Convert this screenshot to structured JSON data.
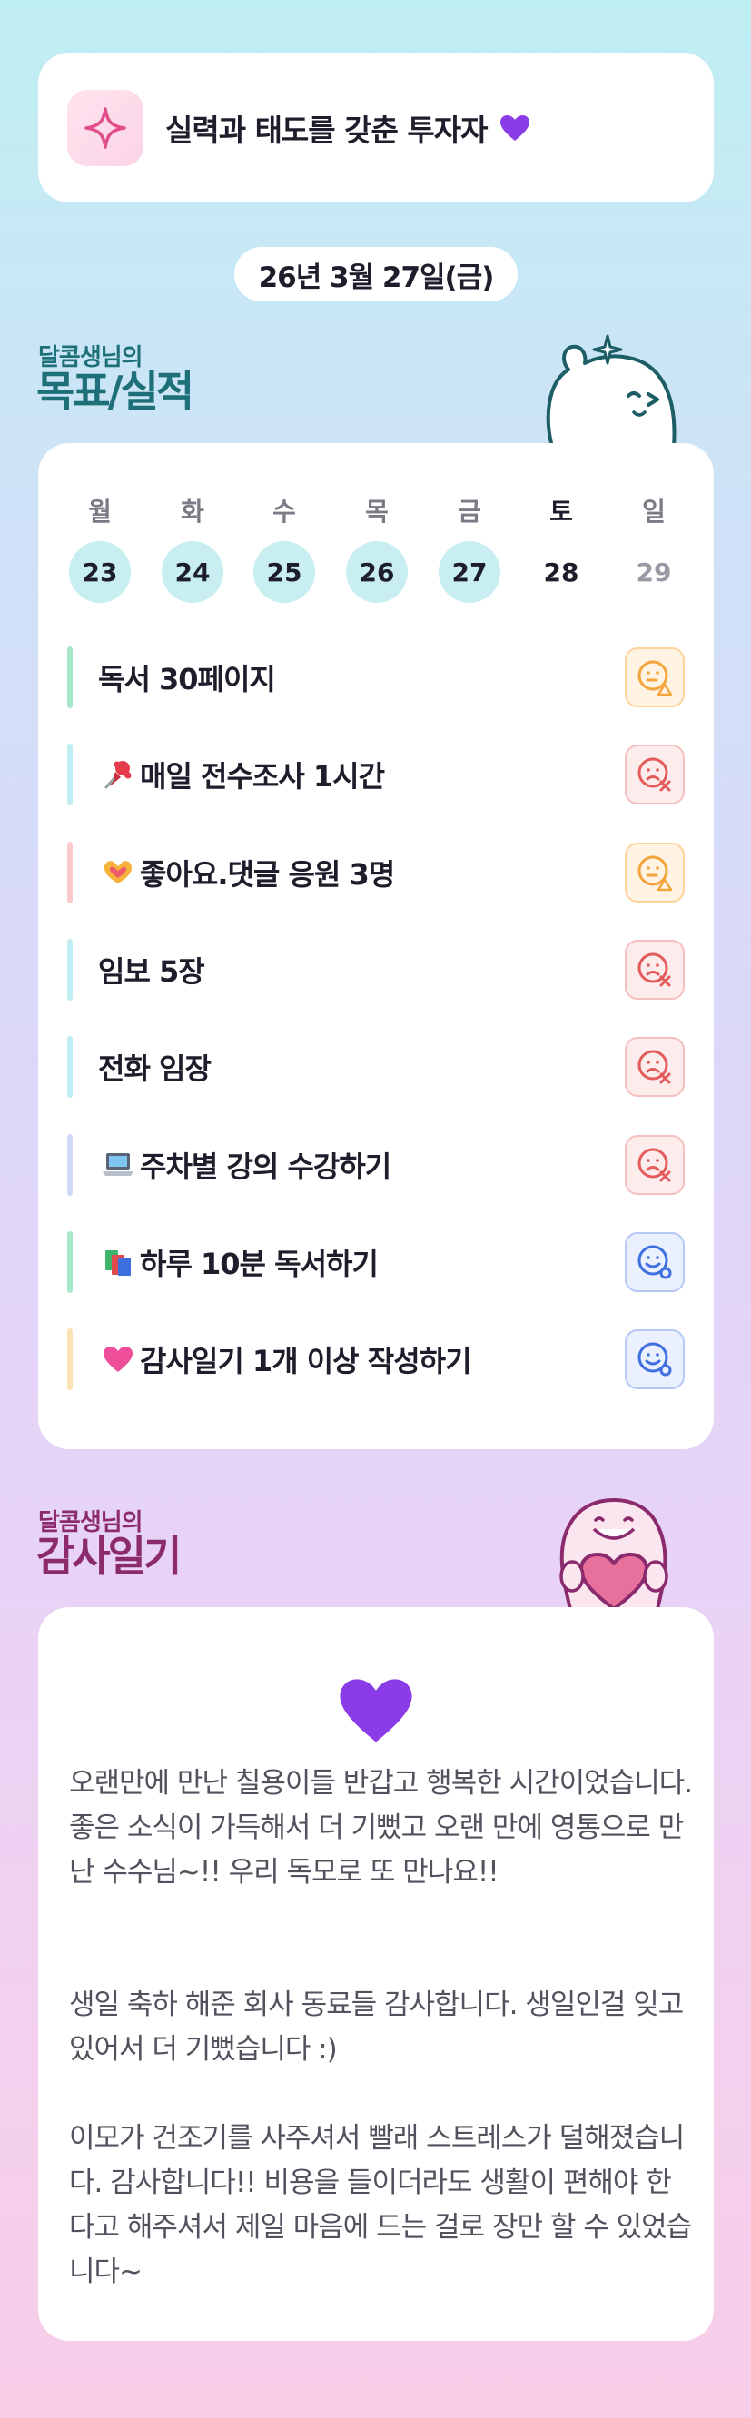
{
  "motto": {
    "text": "실력과 태도를 갖춘 투자자",
    "icon": "sparkle-icon",
    "heart_icon": "purple-heart-icon"
  },
  "date": "26년 3월 27일(금)",
  "goals_section": {
    "small_title": "달콤생님의",
    "big_title": "목표/실적",
    "mascot": "waving-mascot-icon"
  },
  "week": [
    {
      "label": "월",
      "day": "23",
      "state": "done"
    },
    {
      "label": "화",
      "day": "24",
      "state": "done"
    },
    {
      "label": "수",
      "day": "25",
      "state": "done"
    },
    {
      "label": "목",
      "day": "26",
      "state": "done"
    },
    {
      "label": "금",
      "day": "27",
      "state": "done"
    },
    {
      "label": "토",
      "day": "28",
      "state": "today"
    },
    {
      "label": "일",
      "day": "29",
      "state": "muted"
    }
  ],
  "goals": [
    {
      "text": "독서 30페이지",
      "emoji": "",
      "bar_color": "#a6e8c9",
      "status": "partial"
    },
    {
      "text": "매일 전수조사 1시간",
      "emoji": "pushpin-icon",
      "bar_color": "#bfeef3",
      "status": "fail"
    },
    {
      "text": "좋아요.댓글 응원 3명",
      "emoji": "heart-hands-icon",
      "bar_color": "#fbc9c9",
      "status": "partial"
    },
    {
      "text": "임보 5장",
      "emoji": "",
      "bar_color": "#bfeef3",
      "status": "fail"
    },
    {
      "text": "전화 임장",
      "emoji": "",
      "bar_color": "#bfeef3",
      "status": "fail"
    },
    {
      "text": " 주차별 강의 수강하기",
      "emoji": "laptop-icon",
      "bar_color": "#cfd9f6",
      "status": "fail"
    },
    {
      "text": " 하루 10분 독서하기",
      "emoji": "books-icon",
      "bar_color": "#a6e8c9",
      "status": "success"
    },
    {
      "text": " 감사일기 1개 이상 작성하기",
      "emoji": "pink-heart-icon",
      "bar_color": "#fbe3b4",
      "status": "success"
    }
  ],
  "diary_section": {
    "small_title": "달콤생님의",
    "big_title": "감사일기",
    "mascot": "heart-mascot-icon",
    "heart_icon": "purple-heart-icon"
  },
  "diary_paragraphs": [
    "오랜만에 만난 칠용이들 반갑고 행복한 시간이었습니다. 좋은 소식이 가득해서 더 기뻤고 오랜 만에 영통으로 만난 수수님~!! 우리 독모로 또 만나요!!",
    "생일 축하 해준 회사 동료들 감사합니다. 생일인걸 잊고 있어서 더 기뻤습니다 :)",
    "이모가 건조기를 사주셔서 빨래 스트레스가 덜해졌습니다. 감사합니다!! 비용을 들이더라도 생활이 편해야 한다고 해주셔서 제일 마음에 드는 걸로 장만 할 수 있었습니다~"
  ],
  "colors": {
    "teal_title": "#1d6f78",
    "magenta_title": "#8b2b6e",
    "partial": "#f3a53b",
    "fail": "#e35b5b",
    "success": "#3f6fe0"
  }
}
